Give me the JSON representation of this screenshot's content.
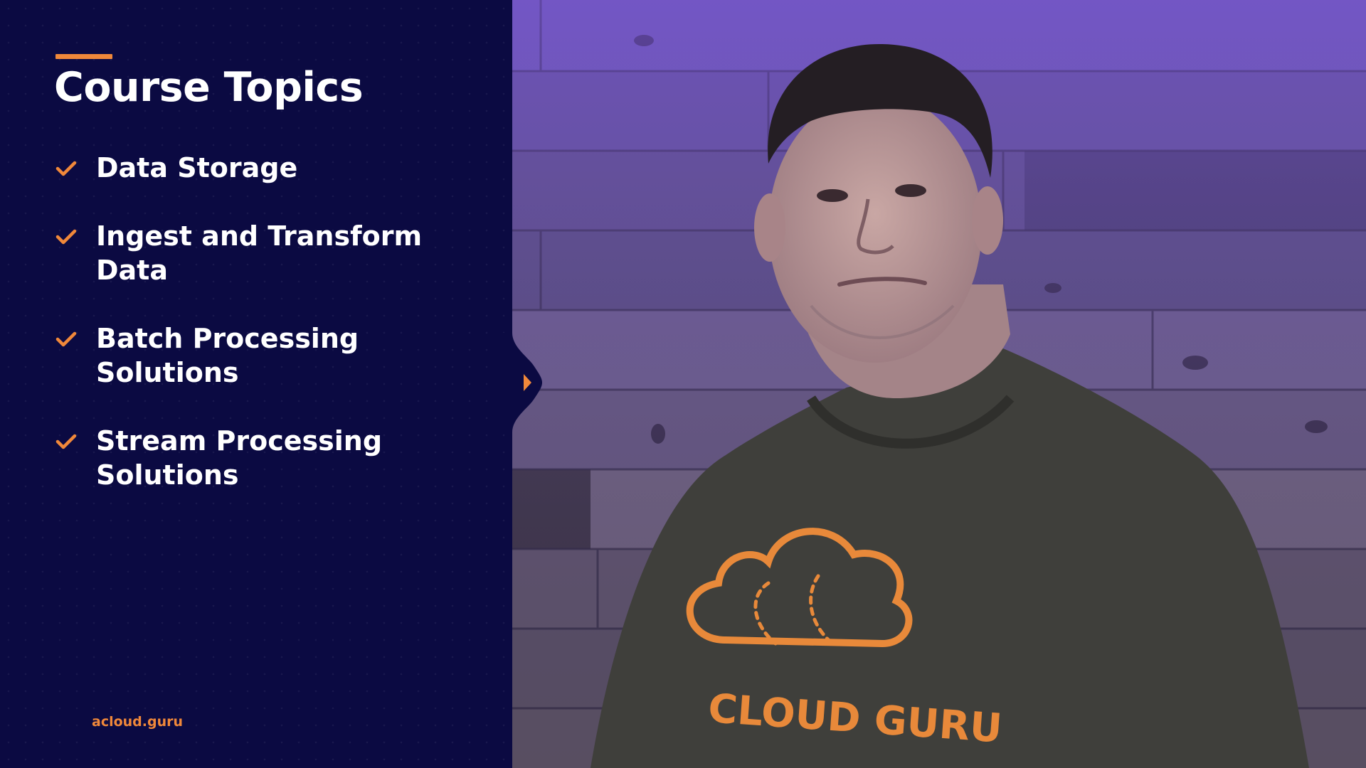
{
  "slide": {
    "title": "Course Topics",
    "topics": [
      {
        "label": "Data Storage",
        "icon": "check-icon"
      },
      {
        "label": "Ingest and Transform Data",
        "icon": "check-icon"
      },
      {
        "label": "Batch Processing Solutions",
        "icon": "check-icon"
      },
      {
        "label": "Stream Processing Solutions",
        "icon": "check-icon"
      }
    ],
    "brand": "acloud.guru"
  },
  "video": {
    "shirt_text": "CLOUD GURU",
    "shirt_logo": "cloud-logo"
  },
  "colors": {
    "panel_bg": "#0b0a42",
    "accent": "#f0883a",
    "text": "#ffffff",
    "wall": "#5b4f86",
    "shirt": "#3f3f3b"
  }
}
